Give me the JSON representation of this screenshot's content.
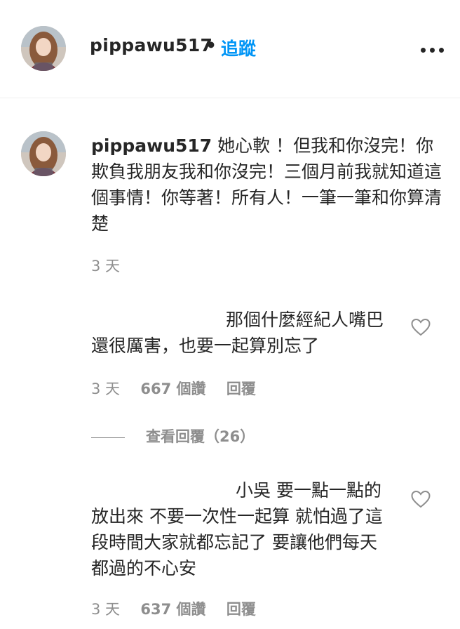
{
  "header": {
    "username": "pippawu517",
    "separator": "•",
    "follow_label": "追蹤",
    "more_icon": "more-horizontal-icon"
  },
  "caption": {
    "username": "pippawu517",
    "text": " 她心軟 ！但我和你沒完！你欺負我朋友我和你沒完！三個月前我就知道這個事情！你等著！所有人！一筆一筆和你算清楚",
    "time": "3 天"
  },
  "comments": [
    {
      "text": "那個什麼經紀人嘴巴還很厲害，也要一起算別忘了",
      "time": "3 天",
      "likes": "667 個讚",
      "reply_label": "回覆",
      "like_icon": "heart-outline-icon"
    },
    {
      "text": "小吳 要一點一點的放出來 不要一次性一起算 就怕過了這段時間大家就都忘記了 要讓他們每天都過的不心安",
      "time": "3 天",
      "likes": "637 個讚",
      "reply_label": "回覆",
      "like_icon": "heart-outline-icon"
    }
  ],
  "view_replies_label": "查看回覆（26）",
  "colors": {
    "text": "#262626",
    "muted": "#8e8e8e",
    "link": "#0095f6",
    "divider": "#efefef"
  }
}
